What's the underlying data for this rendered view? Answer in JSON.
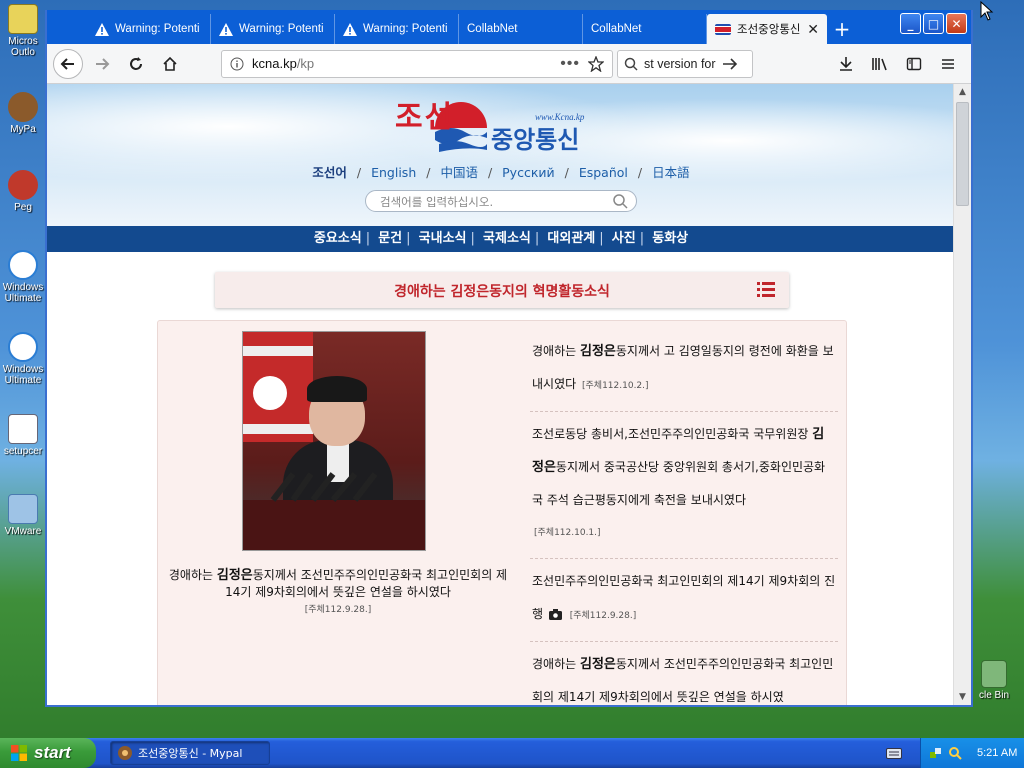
{
  "desktop": {
    "icons": [
      {
        "label": "Micros Outlo",
        "icon": "outlook-icon"
      },
      {
        "label": "MyPa",
        "icon": "mypal-icon"
      },
      {
        "label": "Peg",
        "icon": "pegasus-icon"
      },
      {
        "label": "Windows Ultimate",
        "icon": "ie-icon"
      },
      {
        "label": "Windows Ultimate",
        "icon": "ie-icon"
      },
      {
        "label": "setupcer",
        "icon": "document-icon"
      },
      {
        "label": "VMware",
        "icon": "vmware-icon"
      }
    ],
    "recycle_label": "cle Bin"
  },
  "browser": {
    "tabs": [
      {
        "label": "Warning: Potenti",
        "icon": "warning-icon"
      },
      {
        "label": "Warning: Potenti",
        "icon": "warning-icon"
      },
      {
        "label": "Warning: Potenti",
        "icon": "warning-icon"
      },
      {
        "label": "CollabNet",
        "icon": ""
      },
      {
        "label": "CollabNet",
        "icon": ""
      },
      {
        "label": "조선중앙통신",
        "icon": "kcna-flag-icon",
        "active": true
      }
    ],
    "url": {
      "domain": "kcna.kp",
      "path": "/kp"
    },
    "search_text": "st version for",
    "window_buttons": {
      "minimize": "_",
      "maximize": "□",
      "close": "✕"
    }
  },
  "site": {
    "logo": {
      "line1": "조선",
      "line1b": "선",
      "line2": "중앙통신",
      "www": "www.Kcna.kp"
    },
    "languages": [
      {
        "label": "조선어",
        "current": true
      },
      {
        "label": "English"
      },
      {
        "label": "中国语"
      },
      {
        "label": "Русский"
      },
      {
        "label": "Español"
      },
      {
        "label": "日本語"
      }
    ],
    "search_placeholder": "검색어를 입력하십시오.",
    "nav": [
      "중요소식",
      "문건",
      "국내소식",
      "국제소식",
      "대외관계",
      "사진",
      "동화상"
    ],
    "section_title": "경애하는 김정은동지의 혁명활동소식",
    "lead": {
      "prefix": "경애하는 ",
      "name": "김정은",
      "suffix": "동지께서 조선민주주의인민공화국 최고인민회의 제14기 제9차회의에서 뜻깊은 연설을 하시였다",
      "date": "[주체112.9.28.]"
    },
    "news": [
      {
        "prefix": "경애하는 ",
        "name": "김정은",
        "suffix": "동지께서 고 김영일동지의 령전에 화환을 보내시였다",
        "date": "[주체112.10.2.]",
        "photo": false
      },
      {
        "prefix": "조선로동당 총비서,조선민주주의인민공화국 국무위원장 ",
        "name": "김정은",
        "suffix": "동지께서 중국공산당 중앙위원회 총서기,중화인민공화국 주석 습근평동지에게 축전을 보내시였다",
        "date": "[주체112.10.1.]",
        "photo": false
      },
      {
        "prefix": "조선민주주의인민공화국 최고인민회의 제14기 제9차회의 진행",
        "name": "",
        "suffix": "",
        "date": "[주체112.9.28.]",
        "photo": true
      },
      {
        "prefix": "경애하는 ",
        "name": "김정은",
        "suffix": "동지께서 조선민주주의인민공화국 최고인민회의 제14기 제9차회의에서 뜻깊은 연설을 하시였",
        "date": "",
        "photo": false
      }
    ]
  },
  "taskbar": {
    "start": "start",
    "item": "조선중앙통신 - Mypal",
    "clock": "5:21 AM"
  },
  "colors": {
    "tab_bar": "#0c5fd6",
    "site_nav": "#134a8f",
    "section_title": "#c0262c",
    "taskbar": "#245edb",
    "start": "#3a9b3a"
  }
}
